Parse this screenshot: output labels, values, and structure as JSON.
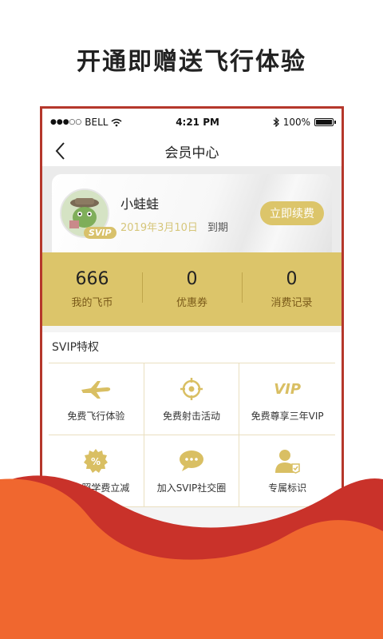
{
  "headline": "开通即赠送飞行体验",
  "statusbar": {
    "signal_dots": "●●●○○",
    "carrier": "BELL",
    "time": "4:21 PM",
    "battery": "100%"
  },
  "nav": {
    "title": "会员中心"
  },
  "member": {
    "name": "小蛙蛙",
    "expire_date": "2019年3月10日",
    "expire_suffix": "到期",
    "badge": "SVIP",
    "renew_label": "立即续费"
  },
  "stats": [
    {
      "value": "666",
      "label": "我的飞币"
    },
    {
      "value": "0",
      "label": "优惠券"
    },
    {
      "value": "0",
      "label": "消费记录"
    }
  ],
  "privileges": {
    "title": "SVIP特权",
    "items": [
      {
        "label": "免费飞行体验",
        "icon": "airplane-icon"
      },
      {
        "label": "免费射击活动",
        "icon": "target-icon"
      },
      {
        "label": "免费尊享三年VIP",
        "icon": "vip-icon",
        "icon_text": "VIP"
      },
      {
        "label": "考飞照学费立减",
        "icon": "discount-icon"
      },
      {
        "label": "加入SVIP社交圈",
        "icon": "chat-icon"
      },
      {
        "label": "专属标识",
        "icon": "user-badge-icon"
      }
    ]
  },
  "colors": {
    "gold": "#dcc56a",
    "frame_red": "#b5372b",
    "wave_orange": "#f0672f",
    "wave_red": "#c9322a"
  }
}
